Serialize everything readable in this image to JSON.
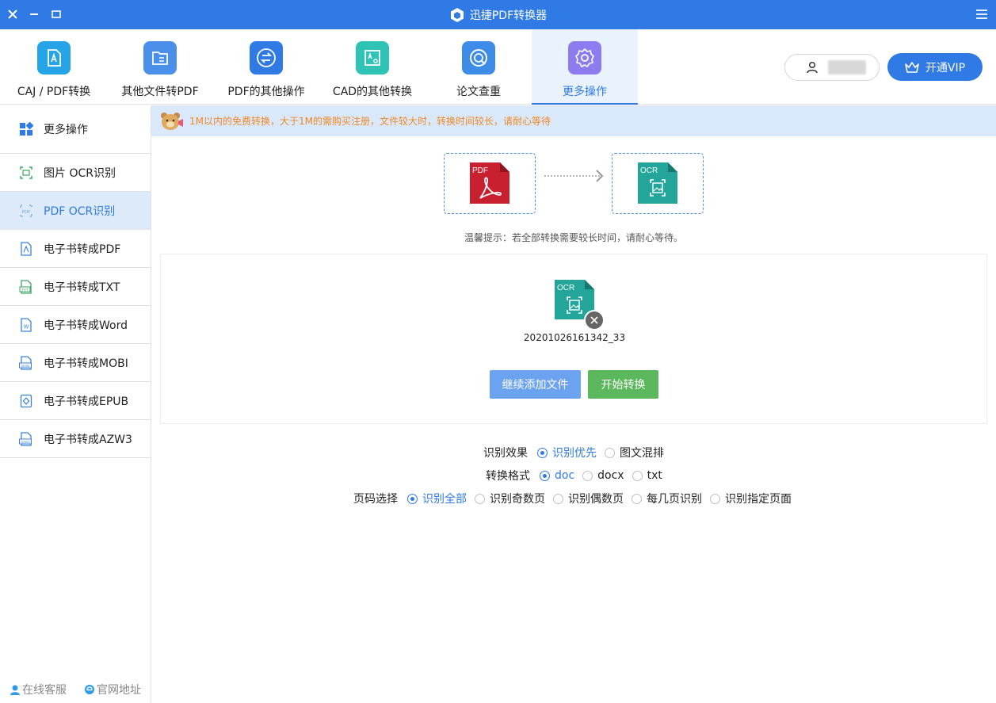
{
  "window": {
    "title": "迅捷PDF转换器"
  },
  "toolbar": {
    "items": [
      {
        "label": "CAJ / PDF转换",
        "icon": "caj-pdf-icon",
        "color": "#26a4e8"
      },
      {
        "label": "其他文件转PDF",
        "icon": "folder-icon",
        "color": "#4a8fe9"
      },
      {
        "label": "PDF的其他操作",
        "icon": "swap-icon",
        "color": "#2f7ae5"
      },
      {
        "label": "CAD的其他转换",
        "icon": "cad-icon",
        "color": "#2ec3b5"
      },
      {
        "label": "论文查重",
        "icon": "paper-check-icon",
        "color": "#3c8ce8"
      },
      {
        "label": "更多操作",
        "icon": "gear-icon",
        "color": "#8c7cf0"
      }
    ],
    "active_index": 5,
    "user_name": "",
    "vip_label": "开通VIP"
  },
  "sidebar": {
    "items": [
      {
        "label": "更多操作",
        "icon": "grid-icon"
      },
      {
        "label": "图片 OCR识别",
        "icon": "image-ocr-icon"
      },
      {
        "label": "PDF OCR识别",
        "icon": "pdf-ocr-icon"
      },
      {
        "label": "电子书转成PDF",
        "icon": "pdf-file-icon"
      },
      {
        "label": "电子书转成TXT",
        "icon": "txt-file-icon"
      },
      {
        "label": "电子书转成Word",
        "icon": "word-file-icon"
      },
      {
        "label": "电子书转成MOBI",
        "icon": "mobi-file-icon"
      },
      {
        "label": "电子书转成EPUB",
        "icon": "epub-file-icon"
      },
      {
        "label": "电子书转成AZW3",
        "icon": "azw3-file-icon"
      }
    ],
    "active_index": 2,
    "footer": {
      "service": "在线客服",
      "website": "官网地址"
    }
  },
  "main": {
    "notice": "1M以内的免费转换，大于1M的需购买注册，文件较大时，转换时间较长，请耐心等待",
    "from_format": "PDF",
    "to_format": "OCR",
    "tip": "温馨提示：若全部转换需要较长时间，请耐心等待。",
    "file": {
      "badge": "OCR",
      "name": "20201026161342_33"
    },
    "add_button": "继续添加文件",
    "start_button": "开始转换",
    "options": {
      "effect": {
        "label": "识别效果",
        "choices": [
          "识别优先",
          "图文混排"
        ],
        "selected": 0
      },
      "format": {
        "label": "转换格式",
        "choices": [
          "doc",
          "docx",
          "txt"
        ],
        "selected": 0
      },
      "pages": {
        "label": "页码选择",
        "choices": [
          "识别全部",
          "识别奇数页",
          "识别偶数页",
          "每几页识别",
          "识别指定页面"
        ],
        "selected": 0
      }
    }
  }
}
